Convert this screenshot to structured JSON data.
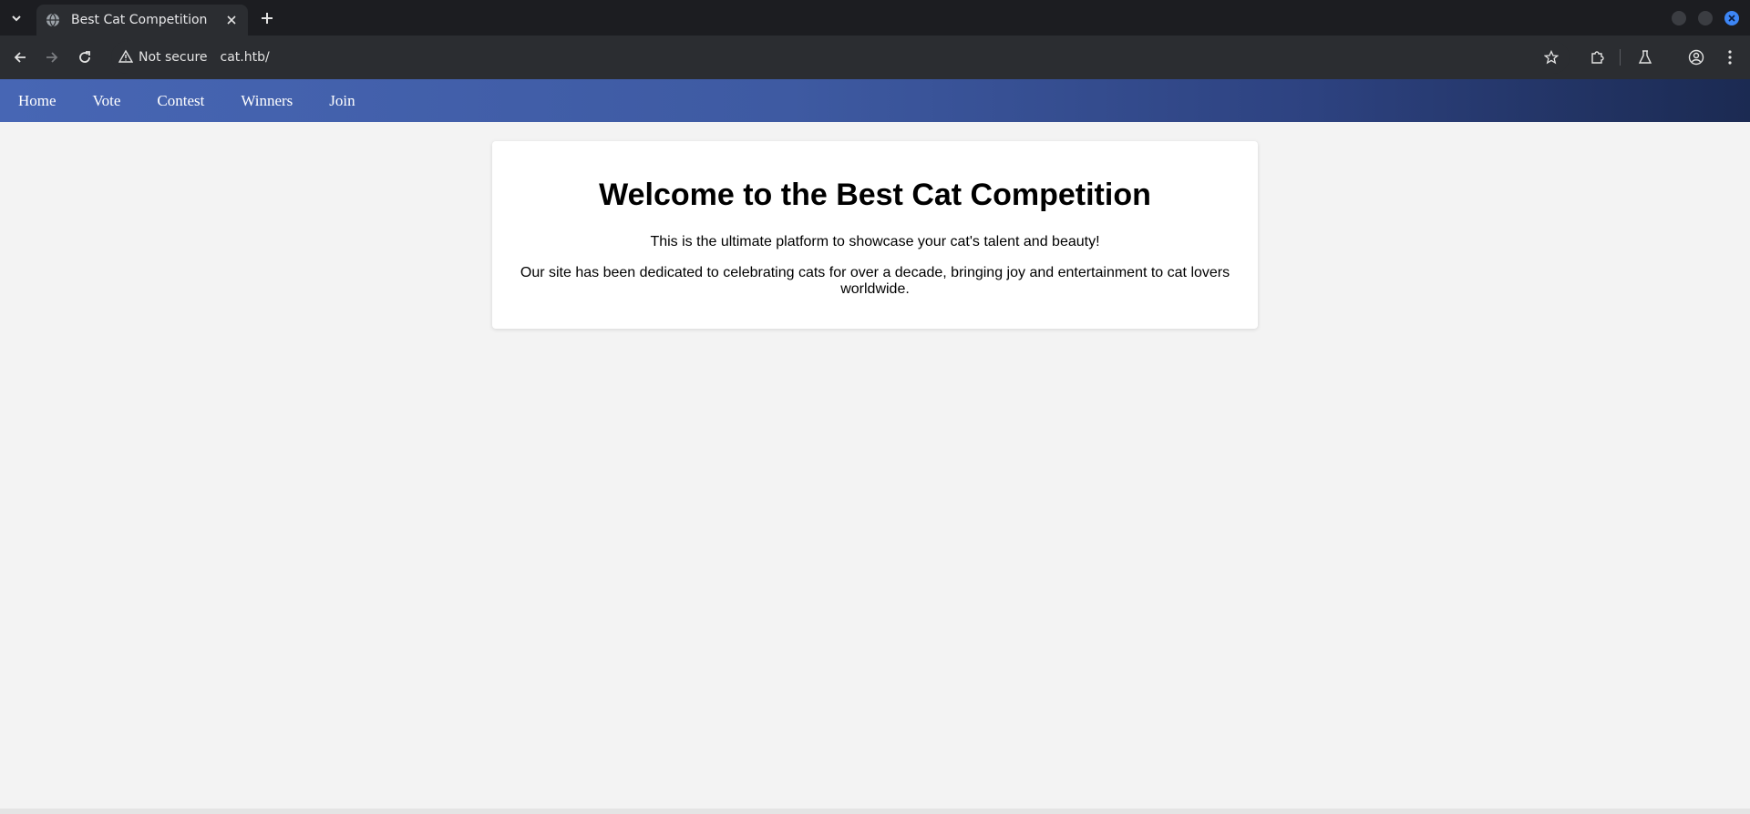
{
  "browser": {
    "tab_title": "Best Cat Competition",
    "security_label": "Not secure",
    "url": "cat.htb/"
  },
  "nav": {
    "links": [
      "Home",
      "Vote",
      "Contest",
      "Winners",
      "Join"
    ]
  },
  "main": {
    "heading": "Welcome to the Best Cat Competition",
    "intro": "This is the ultimate platform to showcase your cat's talent and beauty!",
    "description": "Our site has been dedicated to celebrating cats for over a decade, bringing joy and entertainment to cat lovers worldwide."
  },
  "colors": {
    "nav_gradient_start": "#4766b4",
    "nav_gradient_end": "#1b2a52",
    "page_background": "#f3f3f3",
    "card_background": "#ffffff"
  }
}
